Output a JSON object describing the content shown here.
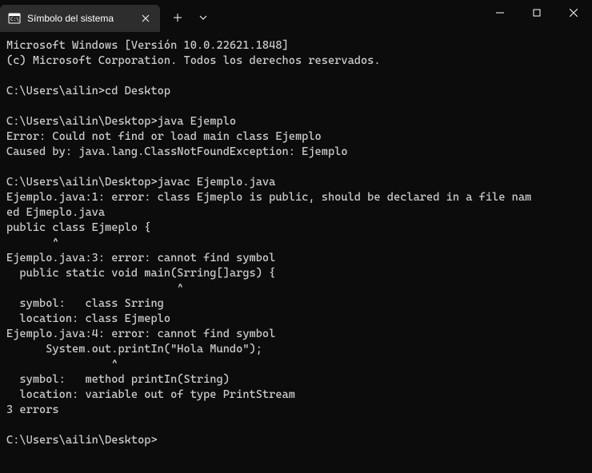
{
  "tab": {
    "title": "Símbolo del sistema"
  },
  "terminal": {
    "content": "Microsoft Windows [Versión 10.0.22621.1848]\n(c) Microsoft Corporation. Todos los derechos reservados.\n\nC:\\Users\\ailin>cd Desktop\n\nC:\\Users\\ailin\\Desktop>java Ejemplo\nError: Could not find or load main class Ejemplo\nCaused by: java.lang.ClassNotFoundException: Ejemplo\n\nC:\\Users\\ailin\\Desktop>javac Ejemplo.java\nEjemplo.java:1: error: class Ejmeplo is public, should be declared in a file nam\ned Ejmeplo.java\npublic class Ejmeplo {\n       ^\nEjemplo.java:3: error: cannot find symbol\n  public static void main(Srring[]args) {\n                          ^\n  symbol:   class Srring\n  location: class Ejmeplo\nEjemplo.java:4: error: cannot find symbol\n      System.out.printIn(\"Hola Mundo\");\n                ^\n  symbol:   method printIn(String)\n  location: variable out of type PrintStream\n3 errors\n\nC:\\Users\\ailin\\Desktop>"
  }
}
